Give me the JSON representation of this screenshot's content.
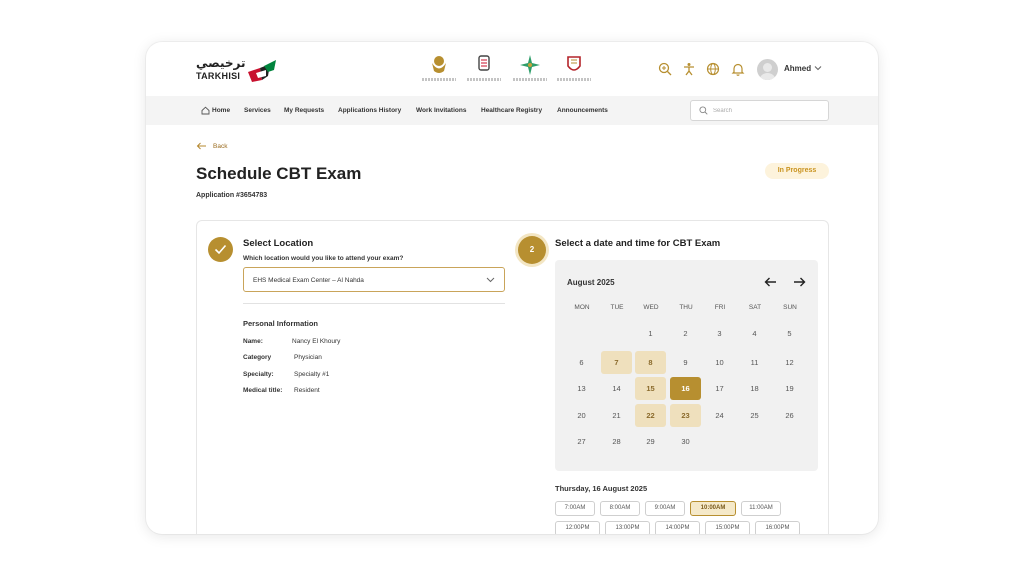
{
  "brand": {
    "name_ar": "ترخيصي",
    "name_en": "TARKHISI"
  },
  "partners": [
    "uae-emblem-icon",
    "abu-dhabi-emblem-icon",
    "star-emblem-icon",
    "crest-emblem-icon"
  ],
  "user": {
    "name": "Ahmed"
  },
  "nav": {
    "home": "Home",
    "services": "Services",
    "requests": "My Requests",
    "history": "Applications History",
    "invitations": "Work Invitations",
    "registry": "Healthcare Registry",
    "announcements": "Announcements"
  },
  "search": {
    "placeholder": "Search"
  },
  "page": {
    "back": "Back",
    "title": "Schedule CBT Exam",
    "application": "Application #3654783",
    "status": "In Progress"
  },
  "step1": {
    "title": "Select Location",
    "question": "Which location would you like to attend your exam?",
    "location": "EHS Medical Exam Center – Al Nahda",
    "personal_title": "Personal Information",
    "fields": [
      {
        "label": "Name:",
        "value": "Nancy El Khoury"
      },
      {
        "label": "Category",
        "value": "Physician"
      },
      {
        "label": "Specialty:",
        "value": "Specialty #1"
      },
      {
        "label": "Medical title:",
        "value": "Resident"
      }
    ]
  },
  "step2": {
    "number": "2",
    "title": "Select a date and time for CBT Exam",
    "calendar": {
      "month": "August 2025",
      "weekdays": [
        "MON",
        "TUE",
        "WED",
        "THU",
        "FRI",
        "SAT",
        "SUN"
      ],
      "rows": [
        [
          "",
          "",
          "1",
          "2",
          "3",
          "4",
          "5"
        ],
        [
          "6",
          "7",
          "8",
          "9",
          "10",
          "11",
          "12"
        ],
        [
          "13",
          "14",
          "15",
          "16",
          "17",
          "18",
          "19"
        ],
        [
          "20",
          "21",
          "22",
          "23",
          "24",
          "25",
          "26"
        ],
        [
          "27",
          "28",
          "29",
          "30",
          "",
          "",
          ""
        ]
      ],
      "available": [
        "7",
        "8",
        "15",
        "22",
        "23"
      ],
      "selected": "16"
    },
    "selected_date": "Thursday, 16 August 2025",
    "slots": [
      [
        "7:00AM",
        "8:00AM",
        "9:00AM",
        "10:00AM",
        "11:00AM"
      ],
      [
        "12:00PM",
        "13:00PM",
        "14:00PM",
        "15:00PM",
        "16:00PM"
      ]
    ],
    "selected_slot": "10:00AM"
  },
  "colors": {
    "accent": "#b78f30",
    "accent_light": "#efe0bd",
    "badge_bg": "#fdf3dc",
    "badge_text": "#c9931f"
  }
}
